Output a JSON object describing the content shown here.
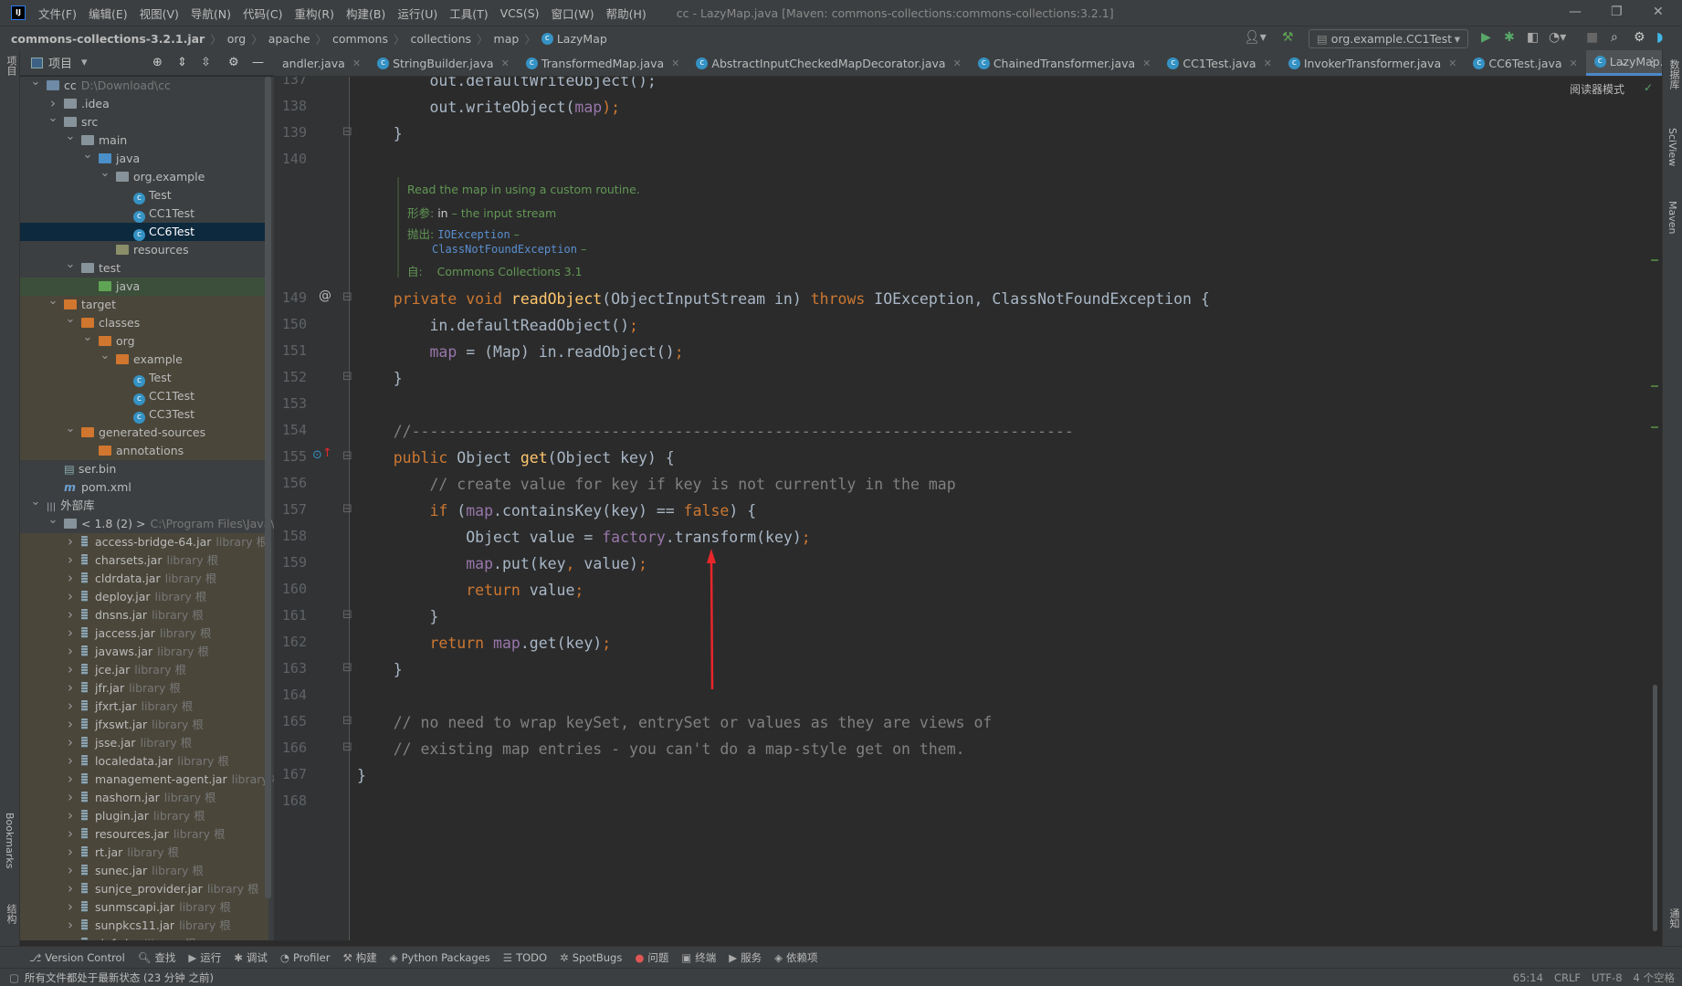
{
  "titlebar": {
    "logo": "IJ",
    "menus": [
      "文件(F)",
      "编辑(E)",
      "视图(V)",
      "导航(N)",
      "代码(C)",
      "重构(R)",
      "构建(B)",
      "运行(U)",
      "工具(T)",
      "VCS(S)",
      "窗口(W)",
      "帮助(H)"
    ],
    "title": "cc - LazyMap.java [Maven: commons-collections:commons-collections:3.2.1]"
  },
  "navbar": {
    "breadcrumbs": [
      "commons-collections-3.2.1.jar",
      "org",
      "apache",
      "commons",
      "collections",
      "map",
      "LazyMap"
    ],
    "run_config": "org.example.CC1Test"
  },
  "left_stripe": {
    "project": "项目",
    "bookmarks": "Bookmarks",
    "structure": "结构"
  },
  "right_stripe": {
    "database": "数据库",
    "sciview": "SciView",
    "maven": "Maven",
    "notifications": "通知"
  },
  "project_panel": {
    "title": "项目",
    "tree": [
      {
        "label": "cc",
        "hint": "D:\\Download\\cc",
        "depth": 0,
        "exp": true,
        "icon": "module",
        "bg": ""
      },
      {
        "label": ".idea",
        "depth": 1,
        "exp": false,
        "icon": "folder",
        "bg": ""
      },
      {
        "label": "src",
        "depth": 1,
        "exp": true,
        "icon": "folder",
        "bg": ""
      },
      {
        "label": "main",
        "depth": 2,
        "exp": true,
        "icon": "folder",
        "bg": ""
      },
      {
        "label": "java",
        "depth": 3,
        "exp": true,
        "icon": "src",
        "bg": ""
      },
      {
        "label": "org.example",
        "depth": 4,
        "exp": true,
        "icon": "package",
        "bg": ""
      },
      {
        "label": "Test",
        "depth": 5,
        "icon": "class",
        "bg": ""
      },
      {
        "label": "CC1Test",
        "depth": 5,
        "icon": "class",
        "bg": ""
      },
      {
        "label": "CC6Test",
        "depth": 5,
        "icon": "class",
        "bg": "sel"
      },
      {
        "label": "resources",
        "depth": 4,
        "icon": "res",
        "bg": ""
      },
      {
        "label": "test",
        "depth": 2,
        "exp": true,
        "icon": "folder",
        "bg": ""
      },
      {
        "label": "java",
        "depth": 3,
        "icon": "test",
        "bg": "greenbg"
      },
      {
        "label": "target",
        "depth": 1,
        "exp": true,
        "icon": "excluded",
        "bg": "olive"
      },
      {
        "label": "classes",
        "depth": 2,
        "exp": true,
        "icon": "excluded",
        "bg": "olive"
      },
      {
        "label": "org",
        "depth": 3,
        "exp": true,
        "icon": "excluded",
        "bg": "olive"
      },
      {
        "label": "example",
        "depth": 4,
        "exp": true,
        "icon": "excluded",
        "bg": "olive"
      },
      {
        "label": "Test",
        "depth": 5,
        "icon": "class",
        "bg": "olive"
      },
      {
        "label": "CC1Test",
        "depth": 5,
        "icon": "class",
        "bg": "olive"
      },
      {
        "label": "CC3Test",
        "depth": 5,
        "icon": "class",
        "bg": "olive"
      },
      {
        "label": "generated-sources",
        "depth": 2,
        "exp": true,
        "icon": "excluded",
        "bg": "olive"
      },
      {
        "label": "annotations",
        "depth": 3,
        "icon": "excluded",
        "bg": "olive"
      },
      {
        "label": "ser.bin",
        "depth": 1,
        "icon": "file",
        "bg": ""
      },
      {
        "label": "pom.xml",
        "depth": 1,
        "icon": "maven",
        "bg": ""
      },
      {
        "label": "外部库",
        "depth": 0,
        "exp": true,
        "icon": "lib",
        "bg": ""
      },
      {
        "label": "< 1.8 (2) >",
        "hint": "C:\\Program Files\\Java\\jdk",
        "depth": 1,
        "exp": true,
        "icon": "jdk",
        "bg": ""
      },
      {
        "label": "access-bridge-64.jar",
        "hint": "library 根",
        "depth": 2,
        "exp": false,
        "icon": "jar",
        "bg": "olive"
      },
      {
        "label": "charsets.jar",
        "hint": "library 根",
        "depth": 2,
        "exp": false,
        "icon": "jar",
        "bg": "olive"
      },
      {
        "label": "cldrdata.jar",
        "hint": "library 根",
        "depth": 2,
        "exp": false,
        "icon": "jar",
        "bg": "olive"
      },
      {
        "label": "deploy.jar",
        "hint": "library 根",
        "depth": 2,
        "exp": false,
        "icon": "jar",
        "bg": "olive"
      },
      {
        "label": "dnsns.jar",
        "hint": "library 根",
        "depth": 2,
        "exp": false,
        "icon": "jar",
        "bg": "olive"
      },
      {
        "label": "jaccess.jar",
        "hint": "library 根",
        "depth": 2,
        "exp": false,
        "icon": "jar",
        "bg": "olive"
      },
      {
        "label": "javaws.jar",
        "hint": "library 根",
        "depth": 2,
        "exp": false,
        "icon": "jar",
        "bg": "olive"
      },
      {
        "label": "jce.jar",
        "hint": "library 根",
        "depth": 2,
        "exp": false,
        "icon": "jar",
        "bg": "olive"
      },
      {
        "label": "jfr.jar",
        "hint": "library 根",
        "depth": 2,
        "exp": false,
        "icon": "jar",
        "bg": "olive"
      },
      {
        "label": "jfxrt.jar",
        "hint": "library 根",
        "depth": 2,
        "exp": false,
        "icon": "jar",
        "bg": "olive"
      },
      {
        "label": "jfxswt.jar",
        "hint": "library 根",
        "depth": 2,
        "exp": false,
        "icon": "jar",
        "bg": "olive"
      },
      {
        "label": "jsse.jar",
        "hint": "library 根",
        "depth": 2,
        "exp": false,
        "icon": "jar",
        "bg": "olive"
      },
      {
        "label": "localedata.jar",
        "hint": "library 根",
        "depth": 2,
        "exp": false,
        "icon": "jar",
        "bg": "olive"
      },
      {
        "label": "management-agent.jar",
        "hint": "library 根",
        "depth": 2,
        "exp": false,
        "icon": "jar",
        "bg": "olive"
      },
      {
        "label": "nashorn.jar",
        "hint": "library 根",
        "depth": 2,
        "exp": false,
        "icon": "jar",
        "bg": "olive"
      },
      {
        "label": "plugin.jar",
        "hint": "library 根",
        "depth": 2,
        "exp": false,
        "icon": "jar",
        "bg": "olive"
      },
      {
        "label": "resources.jar",
        "hint": "library 根",
        "depth": 2,
        "exp": false,
        "icon": "jar",
        "bg": "olive"
      },
      {
        "label": "rt.jar",
        "hint": "library 根",
        "depth": 2,
        "exp": false,
        "icon": "jar",
        "bg": "olive"
      },
      {
        "label": "sunec.jar",
        "hint": "library 根",
        "depth": 2,
        "exp": false,
        "icon": "jar",
        "bg": "olive"
      },
      {
        "label": "sunjce_provider.jar",
        "hint": "library 根",
        "depth": 2,
        "exp": false,
        "icon": "jar",
        "bg": "olive"
      },
      {
        "label": "sunmscapi.jar",
        "hint": "library 根",
        "depth": 2,
        "exp": false,
        "icon": "jar",
        "bg": "olive"
      },
      {
        "label": "sunpkcs11.jar",
        "hint": "library 根",
        "depth": 2,
        "exp": false,
        "icon": "jar",
        "bg": "olive"
      },
      {
        "label": "zipfs.jar",
        "hint": "library 根",
        "depth": 2,
        "exp": false,
        "icon": "jar",
        "bg": "olive"
      }
    ]
  },
  "tabs": [
    {
      "label": "andler.java",
      "active": false
    },
    {
      "label": "StringBuilder.java",
      "active": false
    },
    {
      "label": "TransformedMap.java",
      "active": false
    },
    {
      "label": "AbstractInputCheckedMapDecorator.java",
      "active": false
    },
    {
      "label": "ChainedTransformer.java",
      "active": false
    },
    {
      "label": "CC1Test.java",
      "active": false
    },
    {
      "label": "InvokerTransformer.java",
      "active": false
    },
    {
      "label": "CC6Test.java",
      "active": false
    },
    {
      "label": "LazyMap.java",
      "active": true
    }
  ],
  "editor": {
    "reader_mode": "阅读器模式",
    "doc": {
      "summary": "Read the map in using a custom routine.",
      "param_label": "形参:",
      "param_name": "in",
      "param_desc": "– the input stream",
      "throws_label": "抛出:",
      "throws1": "IOException",
      "throws2": "ClassNotFoundException",
      "dash": "–",
      "since_label": "自:",
      "since": "Commons Collections 3.1"
    },
    "lines_top": [
      {
        "n": "137",
        "t": [
          [
            "        out.defaultWriteObject();",
            "pl"
          ]
        ]
      },
      {
        "n": "138",
        "t": [
          [
            "        out.writeObject(",
            "pl"
          ],
          [
            "map",
            "fld"
          ],
          [
            ");",
            "kw"
          ]
        ]
      },
      {
        "n": "139",
        "t": [
          [
            "    }",
            "pl"
          ]
        ]
      },
      {
        "n": "140",
        "t": []
      }
    ],
    "lines": [
      {
        "n": "149",
        "t": [
          [
            "    private void ",
            "kw"
          ],
          [
            "readObject",
            "fn"
          ],
          [
            "(ObjectInputStream in) ",
            "pl"
          ],
          [
            "throws ",
            "kw"
          ],
          [
            "IOException, ClassNotFoundException {",
            "pl"
          ]
        ]
      },
      {
        "n": "150",
        "t": [
          [
            "        in.defaultReadObject()",
            "pl"
          ],
          [
            ";",
            "kw"
          ]
        ]
      },
      {
        "n": "151",
        "t": [
          [
            "        ",
            "pl"
          ],
          [
            "map",
            "fld"
          ],
          [
            " = (Map) in.readObject()",
            "pl"
          ],
          [
            ";",
            "kw"
          ]
        ]
      },
      {
        "n": "152",
        "t": [
          [
            "    }",
            "pl"
          ]
        ]
      },
      {
        "n": "153",
        "t": []
      },
      {
        "n": "154",
        "t": [
          [
            "    //-------------------------------------------------------------------------",
            "cm"
          ]
        ]
      },
      {
        "n": "155",
        "t": [
          [
            "    public ",
            "kw"
          ],
          [
            "Object ",
            "pl"
          ],
          [
            "get",
            "fn"
          ],
          [
            "(Object key) {",
            "pl"
          ]
        ]
      },
      {
        "n": "156",
        "t": [
          [
            "        // create value for key if key is not currently in the map",
            "cm"
          ]
        ]
      },
      {
        "n": "157",
        "t": [
          [
            "        if ",
            "kw"
          ],
          [
            "(",
            "pl"
          ],
          [
            "map",
            "fld"
          ],
          [
            ".containsKey(key) == ",
            "pl"
          ],
          [
            "false",
            "kw"
          ],
          [
            ") {",
            "pl"
          ]
        ]
      },
      {
        "n": "158",
        "t": [
          [
            "            Object value = ",
            "pl"
          ],
          [
            "factory",
            "fld"
          ],
          [
            ".transform(key)",
            "pl"
          ],
          [
            ";",
            "kw"
          ]
        ]
      },
      {
        "n": "159",
        "t": [
          [
            "            ",
            "pl"
          ],
          [
            "map",
            "fld"
          ],
          [
            ".put(key",
            "pl"
          ],
          [
            ", ",
            "kw"
          ],
          [
            "value)",
            "pl"
          ],
          [
            ";",
            "kw"
          ]
        ]
      },
      {
        "n": "160",
        "t": [
          [
            "            return ",
            "kw"
          ],
          [
            "value",
            "pl"
          ],
          [
            ";",
            "kw"
          ]
        ]
      },
      {
        "n": "161",
        "t": [
          [
            "        }",
            "pl"
          ]
        ]
      },
      {
        "n": "162",
        "t": [
          [
            "        return ",
            "kw"
          ],
          [
            "map",
            "fld"
          ],
          [
            ".get(key)",
            "pl"
          ],
          [
            ";",
            "kw"
          ]
        ]
      },
      {
        "n": "163",
        "t": [
          [
            "    }",
            "pl"
          ]
        ]
      },
      {
        "n": "164",
        "t": []
      },
      {
        "n": "165",
        "t": [
          [
            "    // no need to wrap keySet, entrySet or values as they are views of",
            "cm"
          ]
        ]
      },
      {
        "n": "166",
        "t": [
          [
            "    // existing map entries - you can't do a map-style get on them.",
            "cm"
          ]
        ]
      },
      {
        "n": "167",
        "t": [
          [
            "}",
            "pl"
          ]
        ]
      },
      {
        "n": "168",
        "t": []
      }
    ],
    "annotation_color": "#e8262b"
  },
  "bottom_toolbar": [
    {
      "icon": "⎇",
      "label": "Version Control"
    },
    {
      "icon": "🔍︎",
      "label": "查找"
    },
    {
      "icon": "▶",
      "label": "运行"
    },
    {
      "icon": "✱",
      "label": "调试"
    },
    {
      "icon": "◔",
      "label": "Profiler"
    },
    {
      "icon": "⚒",
      "label": "构建"
    },
    {
      "icon": "◈",
      "label": "Python Packages"
    },
    {
      "icon": "☰",
      "label": "TODO"
    },
    {
      "icon": "✲",
      "label": "SpotBugs"
    },
    {
      "icon": "●",
      "label": "问题"
    },
    {
      "icon": "▣",
      "label": "终端"
    },
    {
      "icon": "▶",
      "label": "服务"
    },
    {
      "icon": "◈",
      "label": "依赖项"
    }
  ],
  "statusbar": {
    "message": "所有文件都处于最新状态 (23 分钟 之前)",
    "position": "65:14",
    "line_sep": "CRLF",
    "encoding": "UTF-8",
    "indent": "4 个空格"
  }
}
